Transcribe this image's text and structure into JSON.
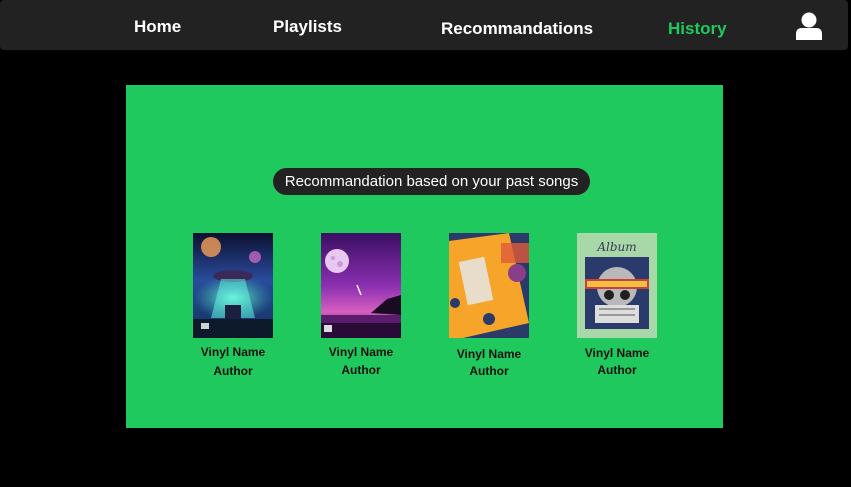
{
  "nav": {
    "home": "Home",
    "playlists": "Playlists",
    "recommendations": "Recommandations",
    "history": "History",
    "active_color": "#1ec95f",
    "account_icon": "user-icon"
  },
  "panel": {
    "title": "Recommandation based on your past songs",
    "background": "#1fc95d"
  },
  "cards": [
    {
      "name": "Vinyl Name",
      "author": "Author",
      "cover_label": ""
    },
    {
      "name": "Vinyl Name",
      "author": "Author",
      "cover_label": ""
    },
    {
      "name": "Vinyl Name",
      "author": "Author",
      "cover_label": ""
    },
    {
      "name": "Vinyl Name",
      "author": "Author",
      "cover_label": "Album"
    }
  ]
}
